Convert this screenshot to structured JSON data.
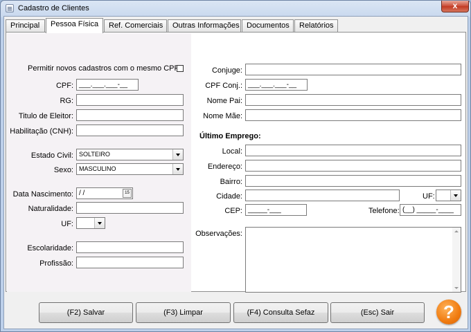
{
  "window": {
    "title": "Cadastro de Clientes",
    "close_glyph": "x"
  },
  "tabs": [
    {
      "label": "Principal"
    },
    {
      "label": "Pessoa Física"
    },
    {
      "label": "Ref. Comerciais"
    },
    {
      "label": "Outras Informações"
    },
    {
      "label": "Documentos"
    },
    {
      "label": "Relatórios"
    }
  ],
  "active_tab": "Pessoa Física",
  "left": {
    "permitir_label": "Permitir novos cadastros com o mesmo CPF:",
    "permitir_checked": false,
    "cpf_label": "CPF:",
    "cpf_value": "___.___.___-__",
    "rg_label": "RG:",
    "rg_value": "",
    "titulo_label": "Titulo de Eleitor:",
    "titulo_value": "",
    "cnh_label": "Habilitação (CNH):",
    "cnh_value": "",
    "estado_civil_label": "Estado Civil:",
    "estado_civil_value": "SOLTEIRO",
    "sexo_label": "Sexo:",
    "sexo_value": "MASCULINO",
    "data_nasc_label": "Data Nascimento:",
    "data_nasc_value": " /  /",
    "calendar_glyph": "15",
    "naturalidade_label": "Naturalidade:",
    "naturalidade_value": "",
    "uf_label": "UF:",
    "uf_value": "",
    "escolaridade_label": "Escolaridade:",
    "escolaridade_value": "",
    "profissao_label": "Profissão:",
    "profissao_value": ""
  },
  "right": {
    "conjuge_label": "Conjuge:",
    "conjuge_value": "",
    "cpf_conj_label": "CPF Conj.:",
    "cpf_conj_value": "___.___.___-__",
    "nome_pai_label": "Nome Pai:",
    "nome_pai_value": "",
    "nome_mae_label": "Nome Mãe:",
    "nome_mae_value": "",
    "ultimo_emprego_title": "Último Emprego:",
    "local_label": "Local:",
    "local_value": "",
    "endereco_label": "Endereço:",
    "endereco_value": "",
    "bairro_label": "Bairro:",
    "bairro_value": "",
    "cidade_label": "Cidade:",
    "cidade_value": "",
    "uf_label": "UF:",
    "uf_value": "",
    "cep_label": "CEP:",
    "cep_value": "_____-___",
    "telefone_label": "Telefone:",
    "telefone_value": "(__) _____-____",
    "observacoes_label": "Observações:",
    "observacoes_value": ""
  },
  "buttons": {
    "salvar": "(F2) Salvar",
    "limpar": "(F3) Limpar",
    "consulta_sefaz": "(F4) Consulta Sefaz",
    "sair": "(Esc) Sair",
    "help": "?"
  }
}
